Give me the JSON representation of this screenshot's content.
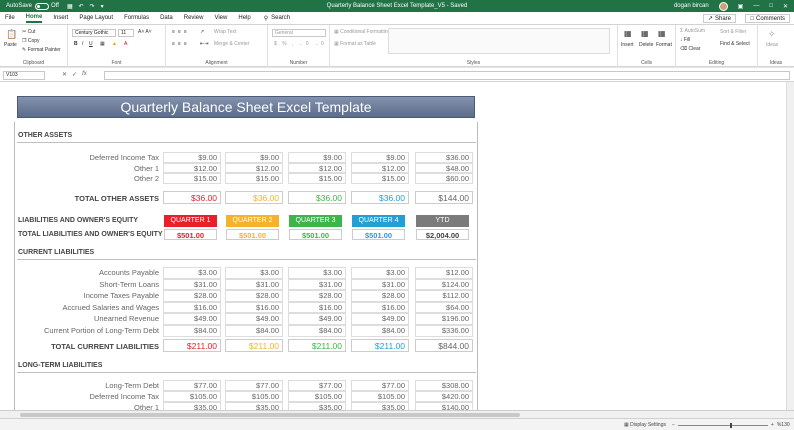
{
  "titlebar": {
    "autosave": "AutoSave",
    "toggle_state": "Off",
    "doc_title": "Quarterly Balance Sheet Excel Template_V5  -  Saved",
    "user": "dogan bircan"
  },
  "menu": {
    "items": [
      "File",
      "Home",
      "Insert",
      "Page Layout",
      "Formulas",
      "Data",
      "Review",
      "View",
      "Help"
    ],
    "active": "Home",
    "search": "Search",
    "share": "Share",
    "comments": "Comments"
  },
  "ribbon": {
    "clipboard": {
      "label": "Clipboard",
      "paste": "Paste",
      "cut": "Cut",
      "copy": "Copy",
      "format_painter": "Format Painter"
    },
    "font": {
      "label": "Font",
      "name": "Century Gothic",
      "size": "11"
    },
    "alignment": {
      "label": "Alignment",
      "wrap": "Wrap Text",
      "merge": "Merge & Center"
    },
    "number": {
      "label": "Number",
      "format": "General"
    },
    "styles": {
      "label": "Styles",
      "cond": "Conditional Formatting",
      "table": "Format as Table"
    },
    "cells": {
      "label": "Cells",
      "insert": "Insert",
      "delete": "Delete",
      "format": "Format"
    },
    "editing": {
      "label": "Editing",
      "autosum": "AutoSum",
      "fill": "Fill",
      "clear": "Clear",
      "sort": "Sort & Filter",
      "find": "Find & Select"
    },
    "ideas": {
      "label": "Ideas",
      "ideas": "Ideas"
    }
  },
  "formula": {
    "namebox": "V103",
    "fx": "fx"
  },
  "sheet": {
    "banner": "Quarterly Balance Sheet Excel Template",
    "other_assets": {
      "title": "OTHER ASSETS",
      "rows": [
        {
          "label": "Deferred Income Tax",
          "values": [
            "$9.00",
            "$9.00",
            "$9.00",
            "$9.00",
            "$36.00"
          ]
        },
        {
          "label": "Other 1",
          "values": [
            "$12.00",
            "$12.00",
            "$12.00",
            "$12.00",
            "$48.00"
          ]
        },
        {
          "label": "Other 2",
          "values": [
            "$15.00",
            "$15.00",
            "$15.00",
            "$15.00",
            "$60.00"
          ]
        }
      ],
      "total_label": "TOTAL OTHER ASSETS",
      "totals": [
        "$36.00",
        "$36.00",
        "$36.00",
        "$36.00",
        "$144.00"
      ]
    },
    "liab_equity": {
      "title": "LIABILITIES AND OWNER'S EQUITY",
      "total_label": "TOTAL LIABILITIES AND OWNER'S EQUITY",
      "headers": [
        "QUARTER 1",
        "QUARTER 2",
        "QUARTER 3",
        "QUARTER 4",
        "YTD"
      ],
      "totals": [
        "$501.00",
        "$501.00",
        "$501.00",
        "$501.00",
        "$2,004.00"
      ]
    },
    "current_liab": {
      "title": "CURRENT LIABILITIES",
      "rows": [
        {
          "label": "Accounts Payable",
          "values": [
            "$3.00",
            "$3.00",
            "$3.00",
            "$3.00",
            "$12.00"
          ]
        },
        {
          "label": "Short-Term Loans",
          "values": [
            "$31.00",
            "$31.00",
            "$31.00",
            "$31.00",
            "$124.00"
          ]
        },
        {
          "label": "Income Taxes Payable",
          "values": [
            "$28.00",
            "$28.00",
            "$28.00",
            "$28.00",
            "$112.00"
          ]
        },
        {
          "label": "Accrued Salaries and Wages",
          "values": [
            "$16.00",
            "$16.00",
            "$16.00",
            "$16.00",
            "$64.00"
          ]
        },
        {
          "label": "Unearned Revenue",
          "values": [
            "$49.00",
            "$49.00",
            "$49.00",
            "$49.00",
            "$196.00"
          ]
        },
        {
          "label": "Current Portion of Long-Term Debt",
          "values": [
            "$84.00",
            "$84.00",
            "$84.00",
            "$84.00",
            "$336.00"
          ]
        }
      ],
      "total_label": "TOTAL CURRENT LIABILITIES",
      "totals": [
        "$211.00",
        "$211.00",
        "$211.00",
        "$211.00",
        "$844.00"
      ]
    },
    "long_term": {
      "title": "LONG-TERM LIABILITIES",
      "rows": [
        {
          "label": "Long-Term Debt",
          "values": [
            "$77.00",
            "$77.00",
            "$77.00",
            "$77.00",
            "$308.00"
          ]
        },
        {
          "label": "Deferred Income Tax",
          "values": [
            "$105.00",
            "$105.00",
            "$105.00",
            "$105.00",
            "$420.00"
          ]
        },
        {
          "label": "Other 1",
          "values": [
            "$35.00",
            "$35.00",
            "$35.00",
            "$35.00",
            "$140.00"
          ]
        }
      ]
    },
    "colors": {
      "q1": "#e8202a",
      "q2": "#f6b22c",
      "q3": "#3cb54a",
      "q4": "#22a0d6",
      "ytd": "#7b7b7b"
    }
  },
  "status": {
    "display_settings": "Display Settings",
    "zoom": "%130"
  }
}
